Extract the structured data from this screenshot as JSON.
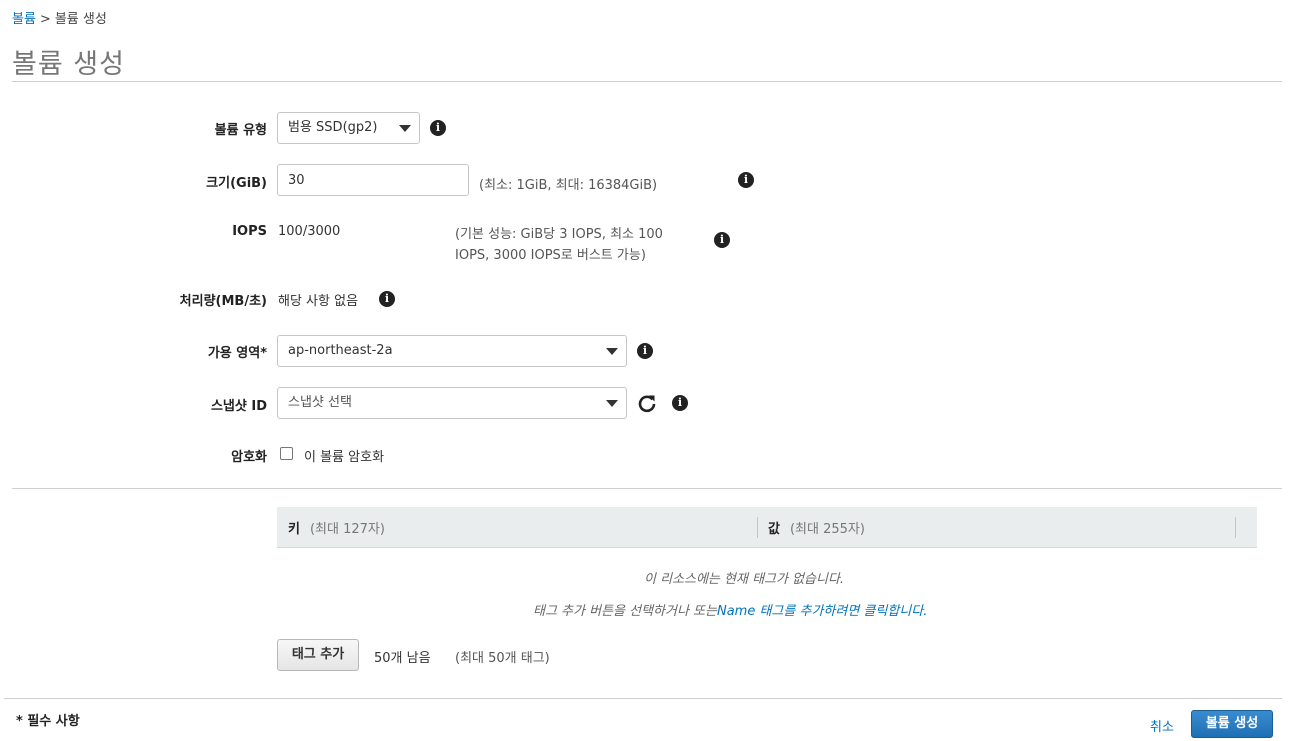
{
  "breadcrumb": {
    "parent": "볼륨",
    "separator": ">",
    "current": "볼륨 생성"
  },
  "page_title": "볼륨 생성",
  "form": {
    "volume_type": {
      "label": "볼륨 유형",
      "value": "범용 SSD(gp2)"
    },
    "size": {
      "label": "크기(GiB)",
      "value": "30",
      "hint": "(최소: 1GiB, 최대: 16384GiB)"
    },
    "iops": {
      "label": "IOPS",
      "value": "100/3000",
      "hint_line1": "(기본 성능: GiB당 3 IOPS, 최소 100",
      "hint_line2": "IOPS, 3000 IOPS로 버스트 가능)"
    },
    "throughput": {
      "label": "처리량(MB/초)",
      "value": "해당 사항 없음"
    },
    "availability_zone": {
      "label": "가용 영역*",
      "value": "ap-northeast-2a"
    },
    "snapshot": {
      "label": "스냅샷 ID",
      "placeholder": "스냅샷 선택"
    },
    "encryption": {
      "label": "암호화",
      "checkbox_label": "이 볼륨 암호화",
      "checked": false
    }
  },
  "tags": {
    "key_header": "키",
    "key_hint": "(최대 127자)",
    "value_header": "값",
    "value_hint": "(최대 255자)",
    "empty_line1": "이 리소스에는 현재 태그가 없습니다.",
    "empty_line2_prefix": "태그 추가 버튼을 선택하거나 또는",
    "empty_line2_link": "Name 태그를 추가하려면 클릭합니다.",
    "add_button": "태그 추가",
    "remaining": "50개 남음",
    "max_hint": "(최대 50개 태그)"
  },
  "footer": {
    "required_note": "* 필수 사항",
    "cancel": "취소",
    "create": "볼륨 생성"
  },
  "colors": {
    "link": "#0073bb",
    "primary": "#1f6fb5"
  }
}
